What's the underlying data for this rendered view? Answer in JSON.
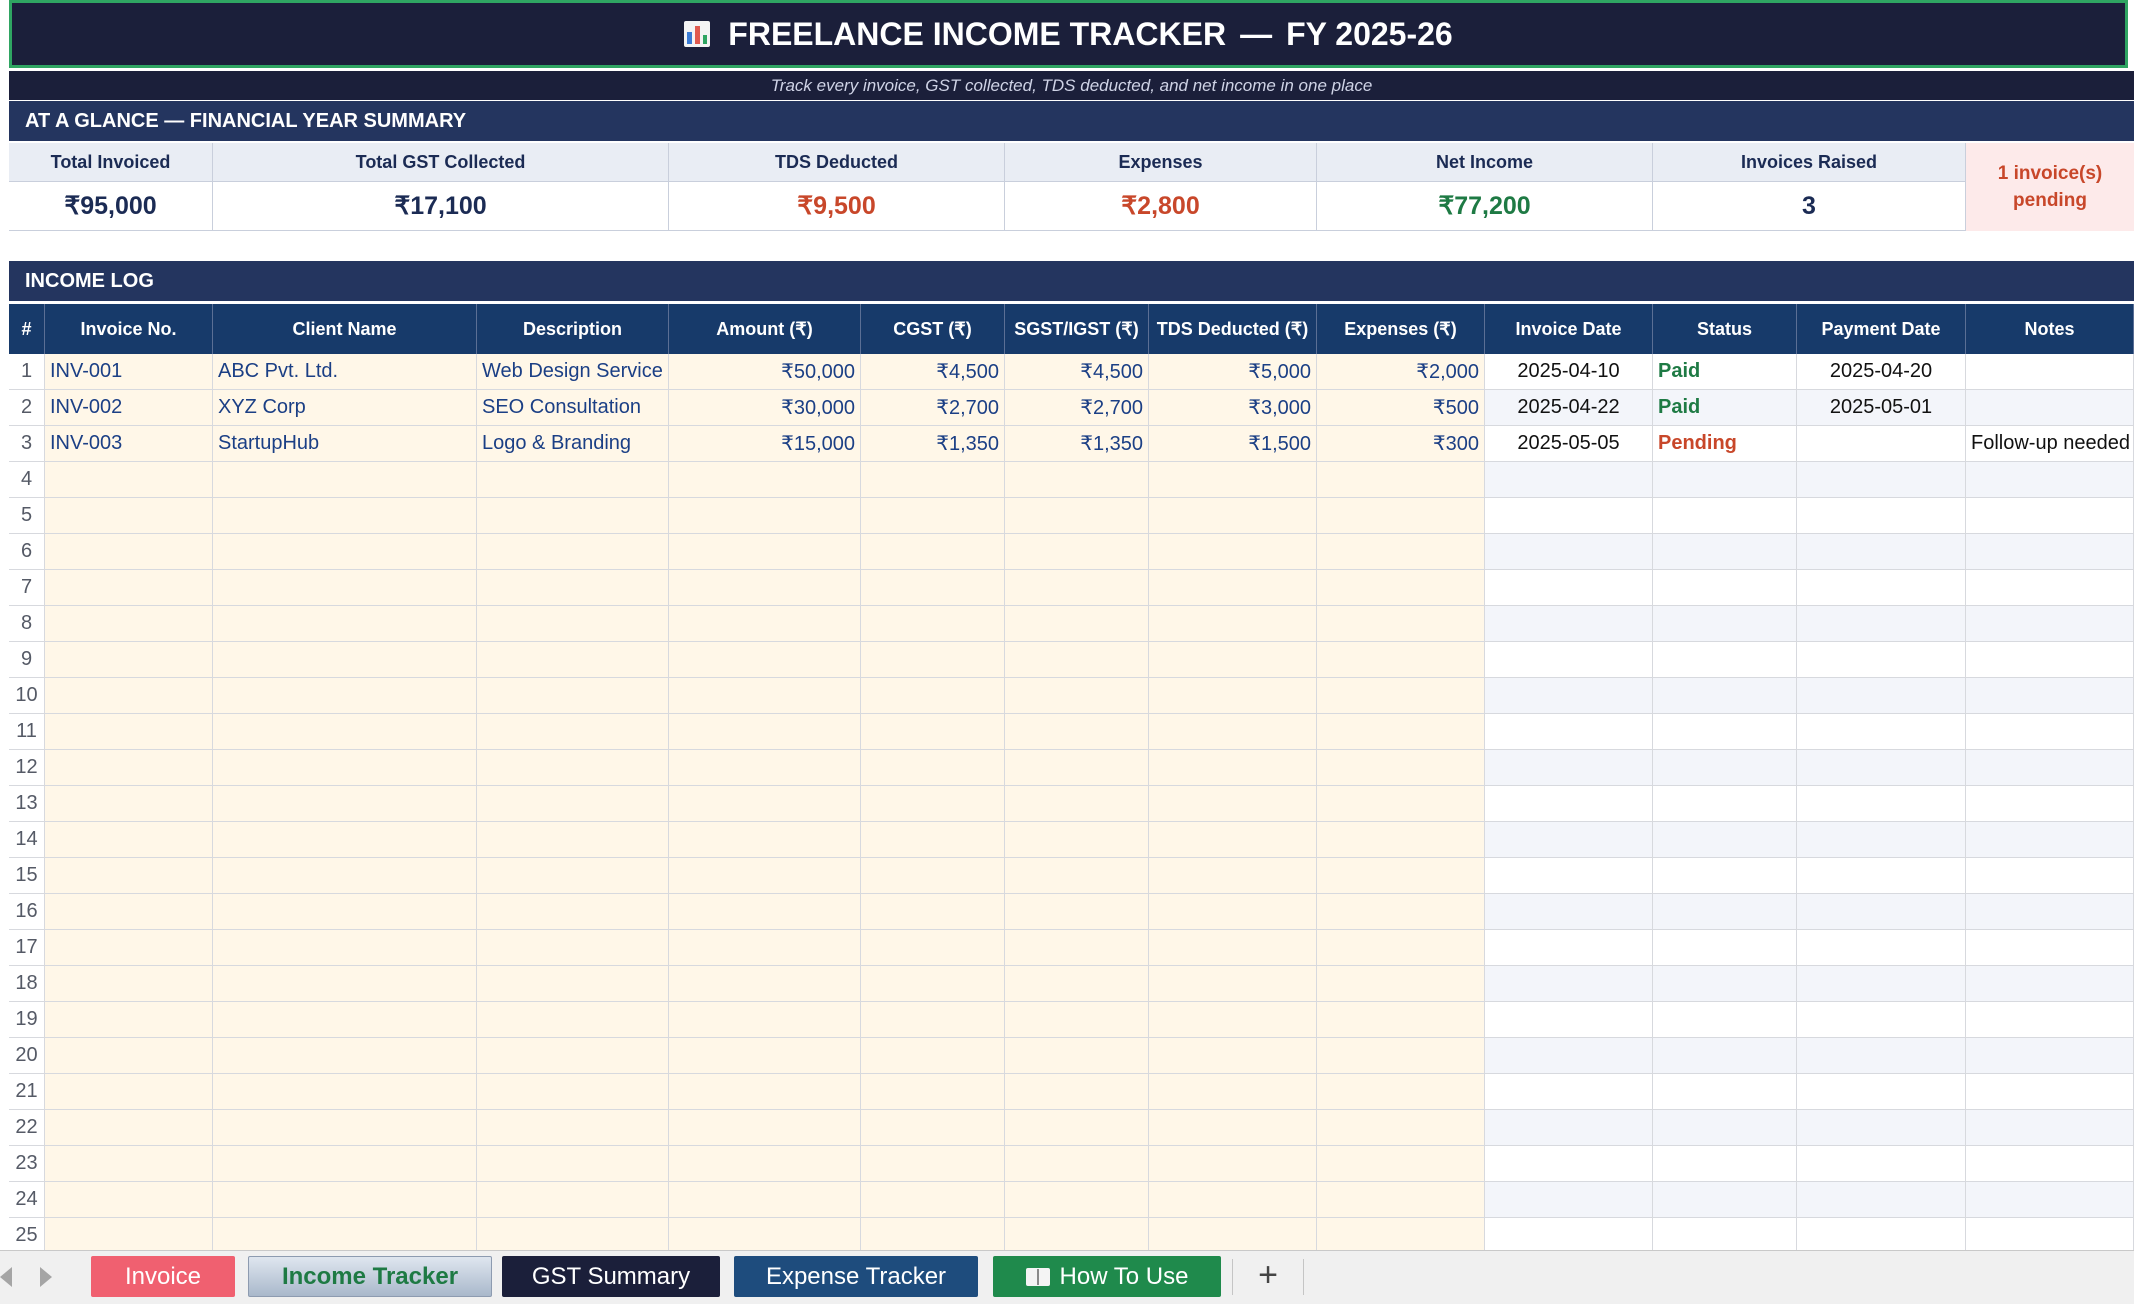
{
  "title": {
    "main": "FREELANCE INCOME TRACKER",
    "separator": "—",
    "fy": "FY 2025-26",
    "icon": "bar-chart-icon",
    "subtitle": "Track every invoice, GST collected, TDS deducted, and net income in one place"
  },
  "summary": {
    "header": "AT A GLANCE — FINANCIAL YEAR SUMMARY",
    "items": [
      {
        "label": "Total Invoiced",
        "value": "₹95,000",
        "color": "#1b2b54"
      },
      {
        "label": "Total GST Collected",
        "value": "₹17,100",
        "color": "#1b2b54"
      },
      {
        "label": "TDS Deducted",
        "value": "₹9,500",
        "color": "#c8472a"
      },
      {
        "label": "Expenses",
        "value": "₹2,800",
        "color": "#c8472a"
      },
      {
        "label": "Net Income",
        "value": "₹77,200",
        "color": "#1e7a44"
      },
      {
        "label": "Invoices Raised",
        "value": "3",
        "color": "#1b2b54"
      }
    ],
    "pending_line1": "1 invoice(s)",
    "pending_line2": "pending"
  },
  "log": {
    "header": "INCOME LOG",
    "columns": [
      "#",
      "Invoice No.",
      "Client Name",
      "Description",
      "Amount (₹)",
      "CGST (₹)",
      "SGST/IGST (₹)",
      "TDS Deducted (₹)",
      "Expenses (₹)",
      "Invoice Date",
      "Status",
      "Payment Date",
      "Notes"
    ],
    "rows": [
      {
        "num": "1",
        "invoice": "INV-001",
        "client": "ABC Pvt. Ltd.",
        "desc": "Web Design Service",
        "amount": "₹50,000",
        "cgst": "₹4,500",
        "sgst": "₹4,500",
        "tds": "₹5,000",
        "exp": "₹2,000",
        "inv_date": "2025-04-10",
        "status": "Paid",
        "pay_date": "2025-04-20",
        "notes": ""
      },
      {
        "num": "2",
        "invoice": "INV-002",
        "client": "XYZ Corp",
        "desc": "SEO Consultation",
        "amount": "₹30,000",
        "cgst": "₹2,700",
        "sgst": "₹2,700",
        "tds": "₹3,000",
        "exp": "₹500",
        "inv_date": "2025-04-22",
        "status": "Paid",
        "pay_date": "2025-05-01",
        "notes": ""
      },
      {
        "num": "3",
        "invoice": "INV-003",
        "client": "StartupHub",
        "desc": "Logo & Branding",
        "amount": "₹15,000",
        "cgst": "₹1,350",
        "sgst": "₹1,350",
        "tds": "₹1,500",
        "exp": "₹300",
        "inv_date": "2025-05-05",
        "status": "Pending",
        "pay_date": "",
        "notes": "Follow-up needed"
      },
      {
        "num": "4"
      },
      {
        "num": "5"
      },
      {
        "num": "6"
      },
      {
        "num": "7"
      },
      {
        "num": "8"
      },
      {
        "num": "9"
      },
      {
        "num": "10"
      },
      {
        "num": "11"
      },
      {
        "num": "12"
      },
      {
        "num": "13"
      },
      {
        "num": "14"
      },
      {
        "num": "15"
      },
      {
        "num": "16"
      },
      {
        "num": "17"
      },
      {
        "num": "18"
      },
      {
        "num": "19"
      },
      {
        "num": "20"
      },
      {
        "num": "21"
      },
      {
        "num": "22"
      },
      {
        "num": "23"
      },
      {
        "num": "24"
      },
      {
        "num": "25"
      }
    ]
  },
  "tabs": {
    "invoice": "Invoice",
    "income": "Income Tracker",
    "gst": "GST Summary",
    "expense": "Expense Tracker",
    "howto": "How To Use",
    "add": "+"
  }
}
